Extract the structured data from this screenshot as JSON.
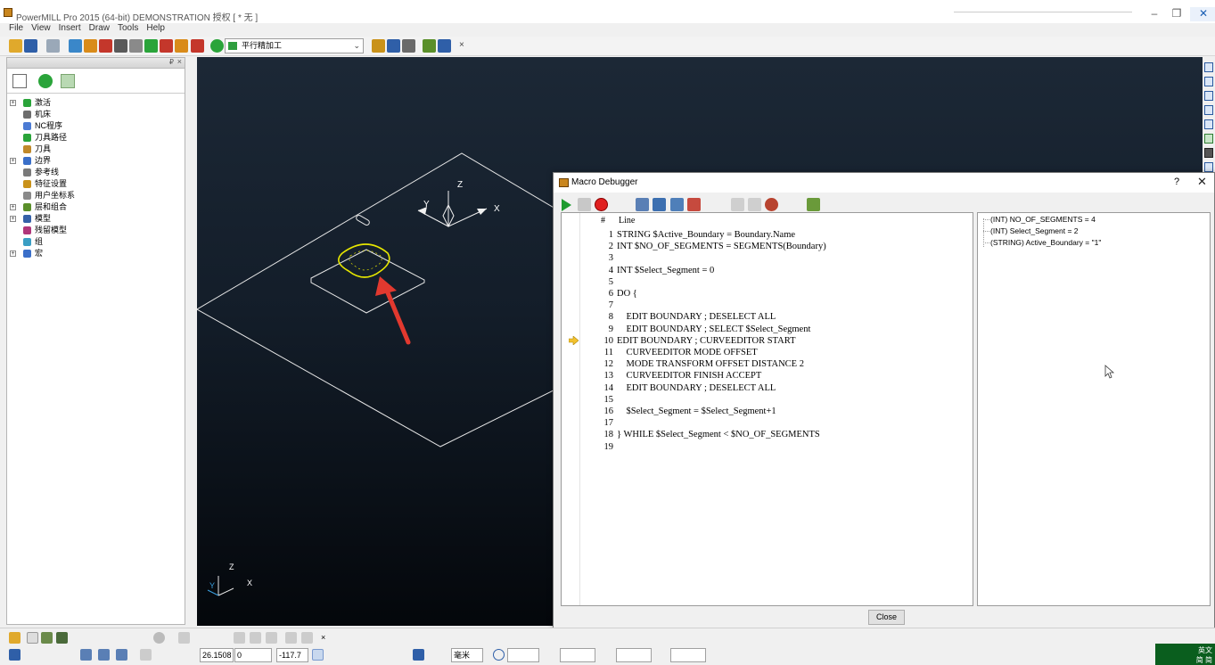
{
  "window": {
    "title": "PowerMILL Pro 2015 (64-bit) DEMONSTRATION 授权   [ * 无 ]",
    "controls": {
      "minimize": "–",
      "maximize": "❐",
      "close": "✕"
    }
  },
  "menu": [
    "File",
    "View",
    "Insert",
    "Draw",
    "Tools",
    "Help"
  ],
  "toolbar": {
    "strategy_combo": "平行精加工",
    "close_label": "×"
  },
  "explorer": {
    "pin": "₽",
    "close": "×",
    "items": [
      {
        "label": "激活",
        "expand": "+",
        "color": "#2aa43a"
      },
      {
        "label": "机床",
        "expand": "",
        "color": "#6d6d6d"
      },
      {
        "label": "NC程序",
        "expand": "",
        "color": "#4b7bd4"
      },
      {
        "label": "刀具路径",
        "expand": "",
        "color": "#2aa43a"
      },
      {
        "label": "刀具",
        "expand": "",
        "color": "#c0892a"
      },
      {
        "label": "边界",
        "expand": "+",
        "color": "#3a6fc9"
      },
      {
        "label": "参考线",
        "expand": "",
        "color": "#7a7a7a"
      },
      {
        "label": "特征设置",
        "expand": "",
        "color": "#c9921a"
      },
      {
        "label": "用户坐标系",
        "expand": "",
        "color": "#8a8a8a"
      },
      {
        "label": "层和组合",
        "expand": "+",
        "color": "#5a8f2a"
      },
      {
        "label": "模型",
        "expand": "+",
        "color": "#3561a8"
      },
      {
        "label": "残留模型",
        "expand": "",
        "color": "#b0367a"
      },
      {
        "label": "组",
        "expand": "",
        "color": "#3a9ec4"
      },
      {
        "label": "宏",
        "expand": "+",
        "color": "#3a6fc9"
      }
    ]
  },
  "viewport": {
    "axis_labels": {
      "x": "X",
      "y": "Y",
      "z": "Z"
    },
    "corner_axes": {
      "x": "X",
      "y": "Y",
      "z": "Z"
    }
  },
  "debugger": {
    "title": "Macro Debugger",
    "help": "?",
    "close_x": "✕",
    "columns": {
      "num": "#",
      "line": "Line"
    },
    "current_line": 10,
    "lines": [
      {
        "n": "1",
        "src": "STRING $Active_Boundary = Boundary.Name"
      },
      {
        "n": "2",
        "src": "INT $NO_OF_SEGMENTS = SEGMENTS(Boundary)"
      },
      {
        "n": "3",
        "src": ""
      },
      {
        "n": "4",
        "src": "INT $Select_Segment = 0"
      },
      {
        "n": "5",
        "src": ""
      },
      {
        "n": "6",
        "src": "DO {"
      },
      {
        "n": "7",
        "src": ""
      },
      {
        "n": "8",
        "src": "    EDIT BOUNDARY ; DESELECT ALL"
      },
      {
        "n": "9",
        "src": "    EDIT BOUNDARY ; SELECT $Select_Segment"
      },
      {
        "n": "10",
        "src": "EDIT BOUNDARY ; CURVEEDITOR START"
      },
      {
        "n": "11",
        "src": "    CURVEEDITOR MODE OFFSET"
      },
      {
        "n": "12",
        "src": "    MODE TRANSFORM OFFSET DISTANCE 2"
      },
      {
        "n": "13",
        "src": "    CURVEEDITOR FINISH ACCEPT"
      },
      {
        "n": "14",
        "src": "    EDIT BOUNDARY ; DESELECT ALL"
      },
      {
        "n": "15",
        "src": ""
      },
      {
        "n": "16",
        "src": "    $Select_Segment = $Select_Segment+1"
      },
      {
        "n": "17",
        "src": ""
      },
      {
        "n": "18",
        "src": "} WHILE $Select_Segment < $NO_OF_SEGMENTS"
      },
      {
        "n": "19",
        "src": ""
      }
    ],
    "variables": [
      "(INT) NO_OF_SEGMENTS = 4",
      "(INT) Select_Segment = 2",
      "(STRING) Active_Boundary = \"1\""
    ],
    "close_button": "Close"
  },
  "status": {
    "coord1": "26.1508",
    "coord2": "0",
    "coord3": "-117.7",
    "units": "毫米"
  },
  "ime": {
    "line1": "英文",
    "line2": "简 简"
  },
  "colors": {
    "accent_green": "#1e9b2f",
    "boundary_yellow": "#e6e600",
    "arrow_red": "#e2392f",
    "viewport_top": "#1c2836",
    "viewport_bottom": "#04070b"
  }
}
